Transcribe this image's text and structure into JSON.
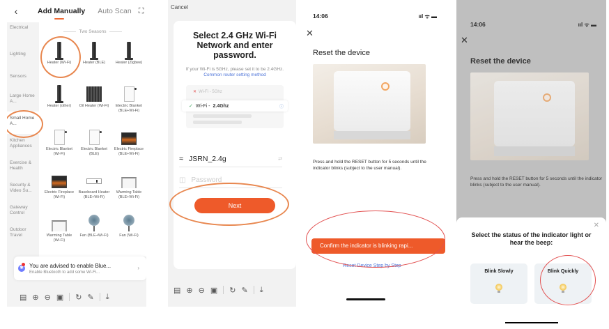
{
  "panel1": {
    "back_icon": "chevron-left-icon",
    "tab_manual": "Add Manually",
    "tab_auto": "Auto Scan",
    "scan_icon": "scan-icon",
    "sidebar": [
      "Electrical",
      "Lighting",
      "Sensors",
      "Large Home A...",
      "Small Home A...",
      "Kitchen Appliances",
      "Exercise & Health",
      "Security & Video Su...",
      "Gateway Control",
      "Outdoor Travel"
    ],
    "section_title": "Two Seasons",
    "devices": [
      {
        "name": "Heater (Wi-Fi)"
      },
      {
        "name": "Heater (BLE)"
      },
      {
        "name": "Heater (Zigbee)"
      },
      {
        "name": "Heater (other)"
      },
      {
        "name": "Oil Heater (Wi-Fi)"
      },
      {
        "name": "Electric Blanket (BLE+Wi-Fi)"
      },
      {
        "name": "Electric Blanket (Wi-Fi)"
      },
      {
        "name": "Electric Blanket (BLE)"
      },
      {
        "name": "Electric Fireplace (BLE+Wi-Fi)"
      },
      {
        "name": "Electric Fireplace (Wi-Fi)"
      },
      {
        "name": "Baseboard Heater (BLE+Wi-Fi)"
      },
      {
        "name": "Warming Table (BLE+Wi-Fi)"
      },
      {
        "name": "Warming Table (Wi-Fi)"
      },
      {
        "name": "Fan (BLE+Wi-Fi)"
      },
      {
        "name": "Fan (Wi-Fi)"
      }
    ],
    "notice_title": "You are advised to enable Blue...",
    "notice_sub": "Enable Bluetooth to add some Wi-Fi...",
    "accent": "#f06a35"
  },
  "panel2": {
    "cancel": "Cancel",
    "title": "Select 2.4 GHz Wi-Fi Network and enter password.",
    "sub_text": "If your Wi-Fi is 5GHz, please set it to be 2.4GHz.",
    "sub_link": "Common router setting method",
    "wifi_5g": "Wi-Fi - 5Ghz",
    "wifi_24_prefix": "Wi-Fi -",
    "wifi_24": "2.4Ghz",
    "ssid": "JSRN_2.4g",
    "password_placeholder": "Password",
    "next": "Next",
    "accent": "#ee5a2a"
  },
  "panel3": {
    "time": "14:06",
    "signal": "ııl ᯤ ▬",
    "title": "Reset the device",
    "desc": "Press and hold the RESET button for 5 seconds until the indicator blinks (subject to the user manual).",
    "confirm": "Confirm the indicator is blinking rapi...",
    "link": "Reset Device Step by Step"
  },
  "panel4": {
    "time": "14:06",
    "signal": "ııl ᯤ ▬",
    "title": "Reset the device",
    "desc": "Press and hold the RESET button for 5 seconds until the indicator blinks (subject to the user manual).",
    "question": "Select the status of the indicator light or hear the beep:",
    "opt_slow": "Blink Slowly",
    "opt_fast": "Blink Quickly"
  },
  "toolbar_icons": [
    "save-icon",
    "zoom-in-icon",
    "zoom-out-icon",
    "fit-page-icon",
    "rotate-icon",
    "pen-icon",
    "download-icon"
  ]
}
